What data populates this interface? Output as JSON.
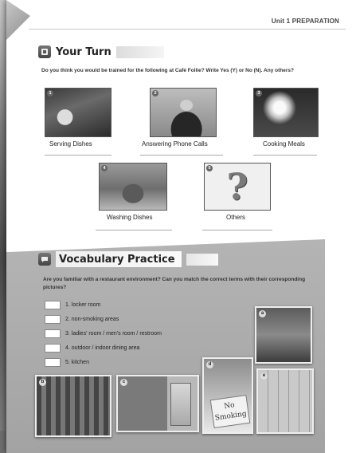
{
  "header": {
    "unit_label": "Unit 1  PREPARATION"
  },
  "your_turn": {
    "title": "Your Turn",
    "question": "Do you think you would be trained for the following at Café Follie? Write Yes (Y) or No (N). Any others?",
    "items": [
      {
        "number": "1",
        "caption": "Serving Dishes"
      },
      {
        "number": "2",
        "caption": "Answering Phone Calls"
      },
      {
        "number": "3",
        "caption": "Cooking Meals"
      },
      {
        "number": "4",
        "caption": "Washing Dishes"
      },
      {
        "number": "5",
        "caption": "Others"
      }
    ]
  },
  "vocabulary": {
    "title": "Vocabulary Practice",
    "question": "Are you familiar with a restaurant environment? Can you match the correct terms with their corresponding pictures?",
    "terms": [
      "1. locker room",
      "2. non-smoking areas",
      "3. ladies' room / men's room / restroom",
      "4. outdoor / indoor dining area",
      "5. kitchen"
    ],
    "photo_labels": [
      "a",
      "b",
      "c",
      "d",
      "e"
    ],
    "sign_text": "No Smoking"
  }
}
